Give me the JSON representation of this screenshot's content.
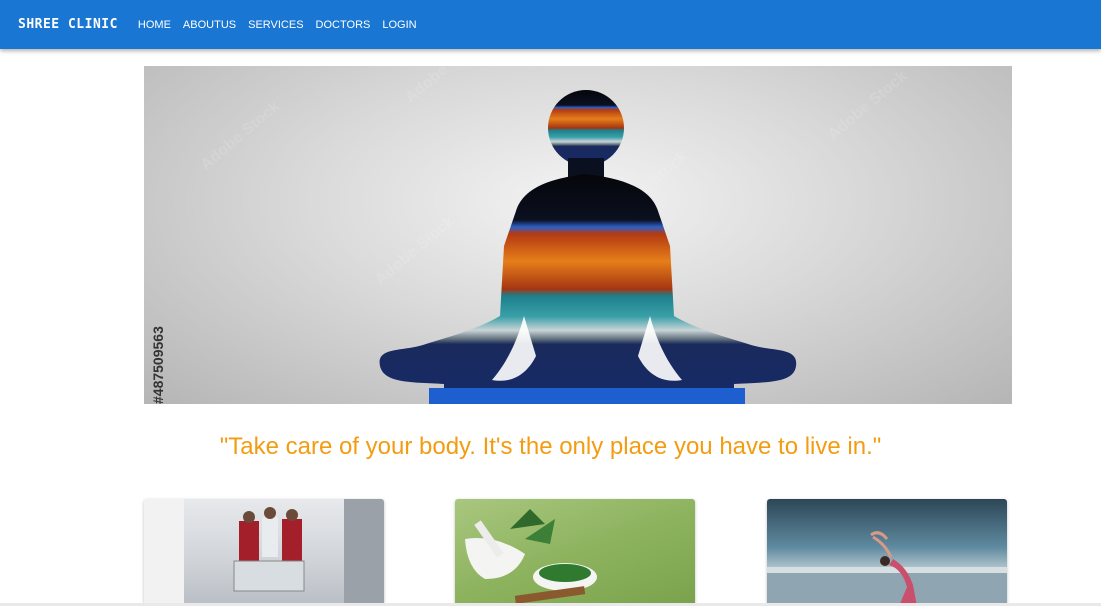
{
  "navbar": {
    "brand": "SHREE CLINIC",
    "links": [
      "HOME",
      "ABOUTUS",
      "SERVICES",
      "DOCTORS",
      "LOGIN"
    ],
    "background": "#1976d2"
  },
  "hero": {
    "stock_id": "#487509563",
    "watermark": "Adobe Stock"
  },
  "quote": {
    "text": "\"Take care of your body. It's the only place you have to live in.\"",
    "color": "#f39c12"
  },
  "cards": [
    {
      "image": "hospital-staff-stretcher-photo"
    },
    {
      "image": "herbs-mortar-pestle-photo"
    },
    {
      "image": "yoga-beach-photo"
    }
  ]
}
